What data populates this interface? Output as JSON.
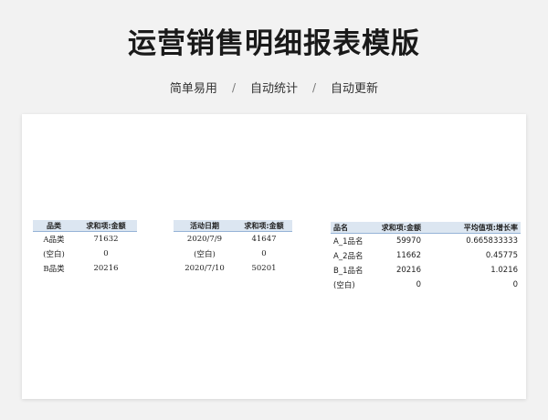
{
  "title": "运营销售明细报表模版",
  "subtitle": {
    "items": [
      "简单易用",
      "自动统计",
      "自动更新"
    ],
    "separator": "/"
  },
  "table1": {
    "headers": [
      "品类",
      "求和项:金额"
    ],
    "rows": [
      [
        "A品类",
        "71632"
      ],
      [
        "(空白)",
        "0"
      ],
      [
        "B品类",
        "20216"
      ]
    ]
  },
  "table2": {
    "headers": [
      "活动日期",
      "求和项:金额"
    ],
    "rows": [
      [
        "2020/7/9",
        "41647"
      ],
      [
        "(空白)",
        "0"
      ],
      [
        "2020/7/10",
        "50201"
      ]
    ]
  },
  "table3": {
    "headers": [
      "品名",
      "求和项:金额",
      "平均值项:增长率"
    ],
    "rows": [
      [
        "A_1品名",
        "59970",
        "0.665833333"
      ],
      [
        "A_2品名",
        "11662",
        "0.45775"
      ],
      [
        "B_1品名",
        "20216",
        "1.0216"
      ],
      [
        "(空白)",
        "0",
        "0"
      ]
    ]
  }
}
